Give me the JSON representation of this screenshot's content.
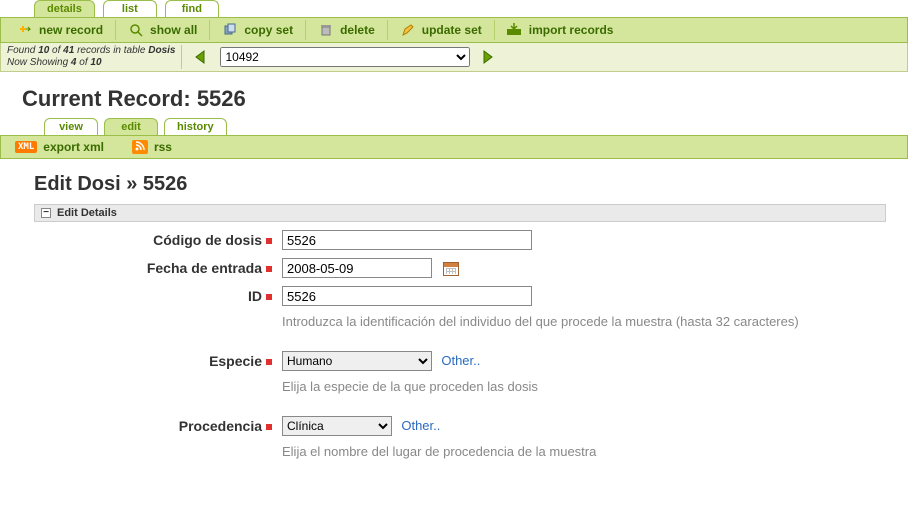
{
  "top_tabs": {
    "details": "details",
    "list": "list",
    "find": "find",
    "active": "details"
  },
  "toolbar": {
    "new_record": "new record",
    "show_all": "show all",
    "copy_set": "copy set",
    "delete": "delete",
    "update_set": "update set",
    "import_records": "import records"
  },
  "records": {
    "found_prefix": "Found ",
    "found_n": "10",
    "found_mid": " of ",
    "found_total": "41",
    "found_suffix": " records in table ",
    "table_name": "Dosis",
    "showing_prefix": "Now Showing ",
    "showing_n": "4",
    "showing_mid": " of ",
    "showing_total": "10",
    "select_value": "10492"
  },
  "current_record": {
    "label": "Current Record:",
    "id": "5526"
  },
  "sub_tabs": {
    "view": "view",
    "edit": "edit",
    "history": "history",
    "active": "edit"
  },
  "subtoolbar": {
    "export_xml": "export xml",
    "rss": "rss"
  },
  "edit_title": {
    "prefix": "Edit Dosi » ",
    "id": "5526"
  },
  "section_head": "Edit Details",
  "fields": {
    "codigo": {
      "label": "Código de dosis",
      "value": "5526"
    },
    "fecha": {
      "label": "Fecha de entrada",
      "value": "2008-05-09"
    },
    "id": {
      "label": "ID",
      "value": "5526",
      "hint": "Introduzca la identificación del individuo del que procede la muestra (hasta 32 caracteres)"
    },
    "especie": {
      "label": "Especie",
      "value": "Humano",
      "other": "Other..",
      "hint": "Elija la especie de la que proceden las dosis"
    },
    "procedencia": {
      "label": "Procedencia",
      "value": "Clínica",
      "other": "Other..",
      "hint": "Elija el nombre del lugar de procedencia de la muestra"
    }
  }
}
